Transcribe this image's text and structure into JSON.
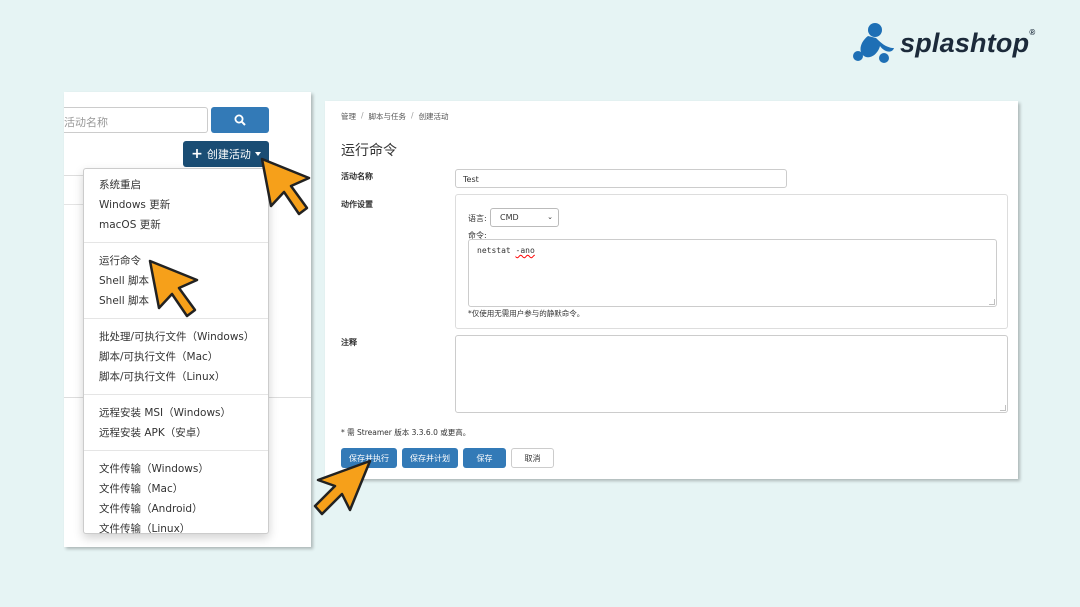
{
  "brand": {
    "name": "splashtop",
    "reg": "®",
    "color": "#1e6fb5"
  },
  "left": {
    "search_placeholder": "活动名称",
    "search_icon": "search-icon",
    "create_button": {
      "plus": "+",
      "label": "创建活动"
    }
  },
  "dropdown": {
    "groups": [
      [
        "系统重启",
        "Windows 更新",
        "macOS 更新"
      ],
      [
        "运行命令",
        "Shell 脚本",
        "Shell 脚本"
      ],
      [
        "批处理/可执行文件（Windows）",
        "脚本/可执行文件（Mac）",
        "脚本/可执行文件（Linux）"
      ],
      [
        "远程安装 MSI（Windows）",
        "远程安装 APK（安卓）"
      ],
      [
        "文件传输（Windows）",
        "文件传输（Mac）",
        "文件传输（Android）",
        "文件传输（Linux）"
      ]
    ]
  },
  "right": {
    "breadcrumb": [
      "管理",
      "脚本与任务",
      "创建活动"
    ],
    "title": "运行命令",
    "name_label": "活动名称",
    "name_value": "Test",
    "action_label": "动作设置",
    "lang_label": "语言:",
    "lang_value": "CMD",
    "cmd_label": "命令:",
    "cmd_prefix": "netstat ",
    "cmd_flag": "-ano",
    "hint": "*仅使用无需用户参与的静默命令。",
    "note_label": "注释",
    "footnote": "* 需 Streamer 版本 3.3.6.0 或更高。",
    "buttons": {
      "save_run": "保存并执行",
      "save_schedule": "保存并计划",
      "save": "保存",
      "cancel": "取消"
    }
  },
  "colors": {
    "primary": "#337ab7",
    "dark_primary": "#1a4d74",
    "cursor": "#f6a01a",
    "background": "#e6f4f4"
  }
}
